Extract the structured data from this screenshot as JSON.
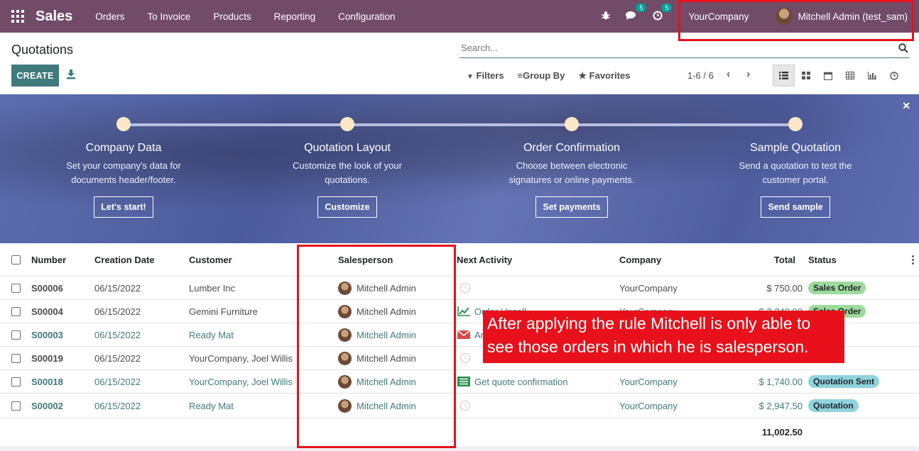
{
  "navbar": {
    "app_name": "Sales",
    "menu": [
      "Orders",
      "To Invoice",
      "Products",
      "Reporting",
      "Configuration"
    ],
    "messages_badge": "5",
    "activities_badge": "5",
    "company": "YourCompany",
    "user": "Mitchell Admin (test_sam)"
  },
  "control_panel": {
    "title": "Quotations",
    "create_label": "CREATE",
    "search_placeholder": "Search...",
    "filters_label": "Filters",
    "group_by_label": "Group By",
    "favorites_label": "Favorites",
    "pager": "1-6 / 6"
  },
  "onboarding": {
    "steps": [
      {
        "title": "Company Data",
        "desc1": "Set your company's data for",
        "desc2": "documents header/footer.",
        "button": "Let's start!"
      },
      {
        "title": "Quotation Layout",
        "desc1": "Customize the look of your",
        "desc2": "quotations.",
        "button": "Customize"
      },
      {
        "title": "Order Confirmation",
        "desc1": "Choose between electronic",
        "desc2": "signatures or online payments.",
        "button": "Set payments"
      },
      {
        "title": "Sample Quotation",
        "desc1": "Send a quotation to test the",
        "desc2": "customer portal.",
        "button": "Send sample"
      }
    ]
  },
  "table": {
    "columns": {
      "number": "Number",
      "creation_date": "Creation Date",
      "customer": "Customer",
      "salesperson": "Salesperson",
      "next_activity": "Next Activity",
      "company": "Company",
      "total": "Total",
      "status": "Status"
    },
    "rows": [
      {
        "number": "S00006",
        "date": "06/15/2022",
        "customer": "Lumber Inc",
        "salesperson": "Mitchell Admin",
        "activity": "",
        "company": "YourCompany",
        "total": "$ 750.00",
        "status": "Sales Order"
      },
      {
        "number": "S00004",
        "date": "06/15/2022",
        "customer": "Gemini Furniture",
        "salesperson": "Mitchell Admin",
        "activity": "Order Upsell",
        "company": "YourCompany",
        "total": "$ 2,240.00",
        "status": "Sales Order"
      },
      {
        "number": "S00003",
        "date": "06/15/2022",
        "customer": "Ready Mat",
        "salesperson": "Mitchell Admin",
        "activity": "Ar",
        "company": "",
        "total": "",
        "status": ""
      },
      {
        "number": "S00019",
        "date": "06/15/2022",
        "customer": "YourCompany, Joel Willis",
        "salesperson": "Mitchell Admin",
        "activity": "",
        "company": "",
        "total": "",
        "status": ""
      },
      {
        "number": "S00018",
        "date": "06/15/2022",
        "customer": "YourCompany, Joel Willis",
        "salesperson": "Mitchell Admin",
        "activity": "Get quote confirmation",
        "company": "YourCompany",
        "total": "$ 1,740.00",
        "status": "Quotation Sent"
      },
      {
        "number": "S00002",
        "date": "06/15/2022",
        "customer": "Ready Mat",
        "salesperson": "Mitchell Admin",
        "activity": "",
        "company": "YourCompany",
        "total": "$ 2,947.50",
        "status": "Quotation"
      }
    ],
    "grand_total": "11,002.50"
  },
  "annotation": {
    "line1": "After applying the rule Mitchell is only able to",
    "line2": "see those orders in which he is salesperson."
  },
  "colors": {
    "navbar": "#714b67",
    "primary": "#3f7a7d",
    "annotation_red": "#e8101a",
    "sales_order_badge": "#9ddb9d",
    "quotation_badge": "#8fd3dc"
  }
}
